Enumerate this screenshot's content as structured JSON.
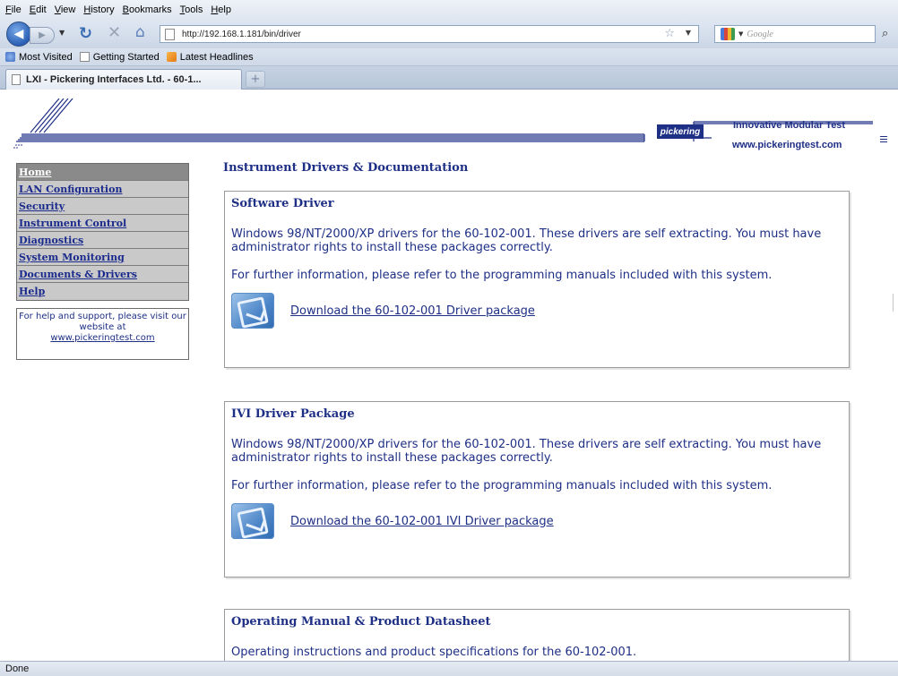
{
  "browser": {
    "menu": [
      "File",
      "Edit",
      "View",
      "History",
      "Bookmarks",
      "Tools",
      "Help"
    ],
    "url": "http://192.168.1.181/bin/driver",
    "search_placeholder": "Google",
    "bookmarks": [
      "Most Visited",
      "Getting Started",
      "Latest Headlines"
    ],
    "tab_title": "LXI - Pickering Interfaces Ltd. - 60-1...",
    "new_tab_symbol": "+",
    "status": "Done"
  },
  "banner": {
    "logo": "pickering",
    "tagline": "Innovative Modular Test",
    "website": "www.pickeringtest.com"
  },
  "sidebar": {
    "items": [
      {
        "label": "Home",
        "active": true
      },
      {
        "label": "LAN Configuration",
        "active": false
      },
      {
        "label": "Security",
        "active": false
      },
      {
        "label": "Instrument Control",
        "active": false
      },
      {
        "label": "Diagnostics",
        "active": false
      },
      {
        "label": "System Monitoring",
        "active": false
      },
      {
        "label": "Documents & Drivers",
        "active": false
      },
      {
        "label": "Help",
        "active": false
      }
    ],
    "help_text": "For help and support, please visit our website at",
    "help_link": "www.pickeringtest.com"
  },
  "main": {
    "title": "Instrument Drivers & Documentation",
    "panels": [
      {
        "heading": "Software Driver",
        "text1": "Windows 98/NT/2000/XP drivers for the 60-102-001. These drivers are self extracting. You must have administrator rights to install these packages correctly.",
        "text2": "For further information, please refer to the programming manuals included with this system.",
        "link": "Download the 60-102-001 Driver package"
      },
      {
        "heading": "IVI Driver Package",
        "text1": "Windows 98/NT/2000/XP drivers for the 60-102-001. These drivers are self extracting. You must have administrator rights to install these packages correctly.",
        "text2": "For further information, please refer to the programming manuals included with this system.",
        "link": "Download the 60-102-001 IVI Driver package"
      },
      {
        "heading": "Operating Manual & Product Datasheet",
        "text1": "Operating instructions and product specifications for the 60-102-001."
      }
    ]
  },
  "colors": {
    "brand_navy": "#1e2f86",
    "nav_bg": "#c9c9c9",
    "nav_active": "#8a8a8a"
  }
}
